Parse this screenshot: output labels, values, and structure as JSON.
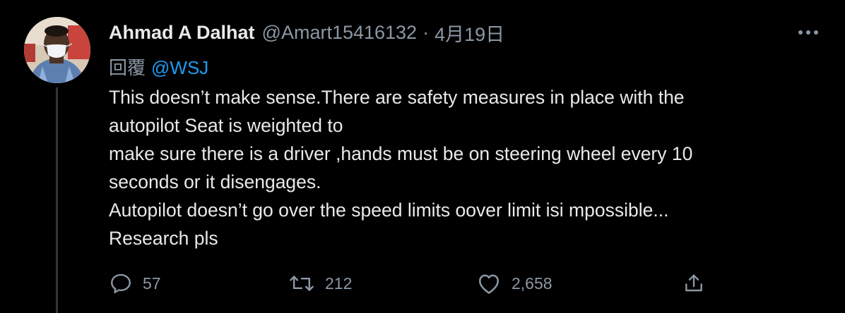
{
  "tweet": {
    "author": {
      "display_name": "Ahmad A Dalhat",
      "handle": "@Amart15416132"
    },
    "separator": "·",
    "date": "4月19日",
    "reply_to": {
      "label": "回覆",
      "mention": "@WSJ"
    },
    "body_lines": [
      "This doesn’t make sense.There are safety measures in place with the",
      "autopilot Seat is weighted to",
      "make sure there is a driver ,hands must be on steering wheel every 10",
      "seconds or it disengages.",
      "Autopilot doesn’t go over the speed limits oover limit isi mpossible...",
      "Research pls"
    ],
    "actions": {
      "reply": {
        "icon": "reply-icon",
        "count": "57"
      },
      "retweet": {
        "icon": "retweet-icon",
        "count": "212"
      },
      "like": {
        "icon": "heart-icon",
        "count": "2,658"
      },
      "share": {
        "icon": "share-icon"
      }
    },
    "more_icon": "more-icon"
  },
  "colors": {
    "background": "#000000",
    "text_primary": "#e7e9ea",
    "text_secondary": "#8b98a5",
    "accent": "#1d9bf0",
    "thread_line": "#333639"
  }
}
